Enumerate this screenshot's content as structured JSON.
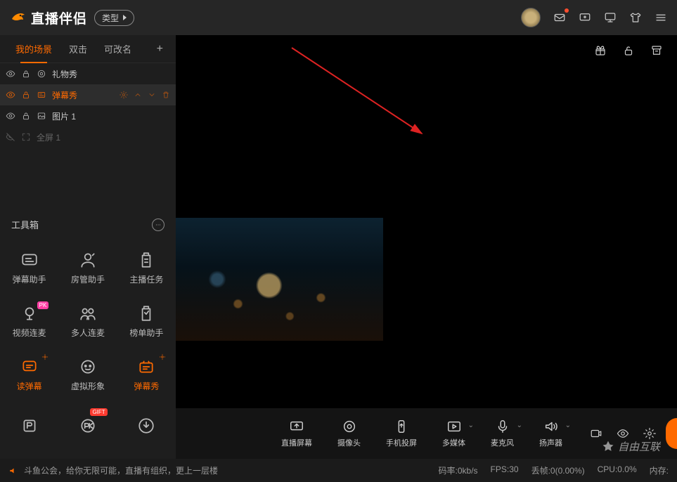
{
  "app": {
    "name": "直播伴侣",
    "type_button_label": "类型"
  },
  "top_icons": [
    "mail",
    "screen",
    "monitor",
    "tshirt",
    "menu"
  ],
  "scene_tabs": {
    "items": [
      "我的场景",
      "双击",
      "可改名"
    ],
    "active_index": 0
  },
  "layers": [
    {
      "name": "礼物秀",
      "icon": "gift-layer",
      "selected": false,
      "dim": false
    },
    {
      "name": "弹幕秀",
      "icon": "danmu-layer",
      "selected": true,
      "dim": false
    },
    {
      "name": "图片 1",
      "icon": "image-layer",
      "selected": false,
      "dim": false
    },
    {
      "name": "全屏 1",
      "icon": "fullscreen-layer",
      "selected": false,
      "dim": true
    }
  ],
  "layer_controls": [
    "settings",
    "up",
    "down",
    "delete"
  ],
  "toolbox": {
    "title": "工具箱",
    "tools": [
      {
        "label": "弹幕助手",
        "icon": "danmu-assist",
        "accent": false
      },
      {
        "label": "房管助手",
        "icon": "moderator",
        "accent": false
      },
      {
        "label": "主播任务",
        "icon": "tasks",
        "accent": false
      },
      {
        "label": "视频连麦",
        "icon": "video-link",
        "accent": false,
        "tag": "PK",
        "tag_cls": "pk"
      },
      {
        "label": "多人连麦",
        "icon": "multi-link",
        "accent": false
      },
      {
        "label": "榜单助手",
        "icon": "leaderboard",
        "accent": false
      },
      {
        "label": "读弹幕",
        "icon": "read-danmu",
        "accent": true,
        "gear": true
      },
      {
        "label": "虚拟形象",
        "icon": "avatar-tool",
        "accent": false
      },
      {
        "label": "弹幕秀",
        "icon": "danmu-show",
        "accent": true,
        "gear": true
      },
      {
        "label": "",
        "icon": "lyrics",
        "accent": false
      },
      {
        "label": "",
        "icon": "pk-tool",
        "accent": false,
        "tag": "GIFT",
        "tag_cls": "gift"
      },
      {
        "label": "",
        "icon": "download",
        "accent": false
      }
    ]
  },
  "main_strip_icons": [
    "gift-box",
    "unlock",
    "archive"
  ],
  "sources": [
    {
      "label": "直播屏幕",
      "icon": "screen-share"
    },
    {
      "label": "摄像头",
      "icon": "camera"
    },
    {
      "label": "手机投屏",
      "icon": "phone-cast"
    },
    {
      "label": "多媒体",
      "icon": "media",
      "chev": true
    },
    {
      "label": "麦克风",
      "icon": "mic",
      "chev": true
    },
    {
      "label": "扬声器",
      "icon": "speaker",
      "chev": true
    }
  ],
  "bottom_right_icons": [
    "record",
    "eye",
    "settings"
  ],
  "status": {
    "left_text": "斗鱼公会，给你无限可能，直播有组织，更上一层楼",
    "bitrate_label": "码率:",
    "bitrate_value": "0kb/s",
    "fps_label": "FPS:",
    "fps_value": "30",
    "drop_label": "丢帧:",
    "drop_value": "0(0.00%)",
    "cpu_label": "CPU:",
    "cpu_value": "0.0%",
    "mem_label": "内存:"
  },
  "watermark": "自由互联"
}
